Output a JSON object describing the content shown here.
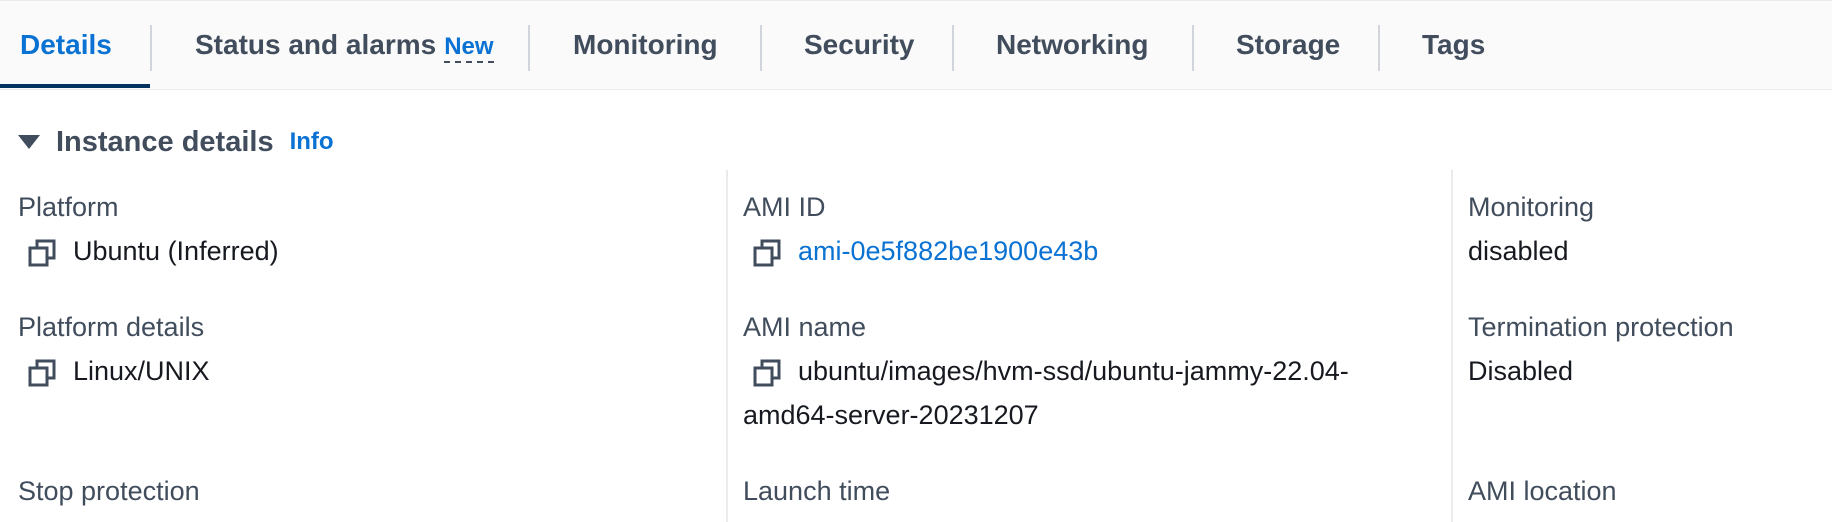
{
  "tabs": [
    {
      "label": "Details",
      "active": true
    },
    {
      "label": "Status and alarms",
      "badge": "New"
    },
    {
      "label": "Monitoring"
    },
    {
      "label": "Security"
    },
    {
      "label": "Networking"
    },
    {
      "label": "Storage"
    },
    {
      "label": "Tags"
    }
  ],
  "section": {
    "title": "Instance details",
    "info_label": "Info"
  },
  "fields": {
    "platform": {
      "label": "Platform",
      "value": "Ubuntu (Inferred)",
      "icon": "copy-icon"
    },
    "platform_details": {
      "label": "Platform details",
      "value": "Linux/UNIX",
      "icon": "copy-icon"
    },
    "stop_protection": {
      "label": "Stop protection"
    },
    "ami_id": {
      "label": "AMI ID",
      "value": "ami-0e5f882be1900e43b",
      "icon": "copy-icon"
    },
    "ami_name": {
      "label": "AMI name",
      "value_line1": "ubuntu/images/hvm-ssd/ubuntu-jammy-22.04-",
      "value_line2": "amd64-server-20231207",
      "icon": "copy-icon"
    },
    "launch_time": {
      "label": "Launch time"
    },
    "monitoring": {
      "label": "Monitoring",
      "value": "disabled"
    },
    "termination_protection": {
      "label": "Termination protection",
      "value": "Disabled"
    },
    "ami_location": {
      "label": "AMI location"
    }
  },
  "colors": {
    "accent": "#0972d3",
    "text_secondary": "#414d5c",
    "text_primary": "#16191f"
  }
}
